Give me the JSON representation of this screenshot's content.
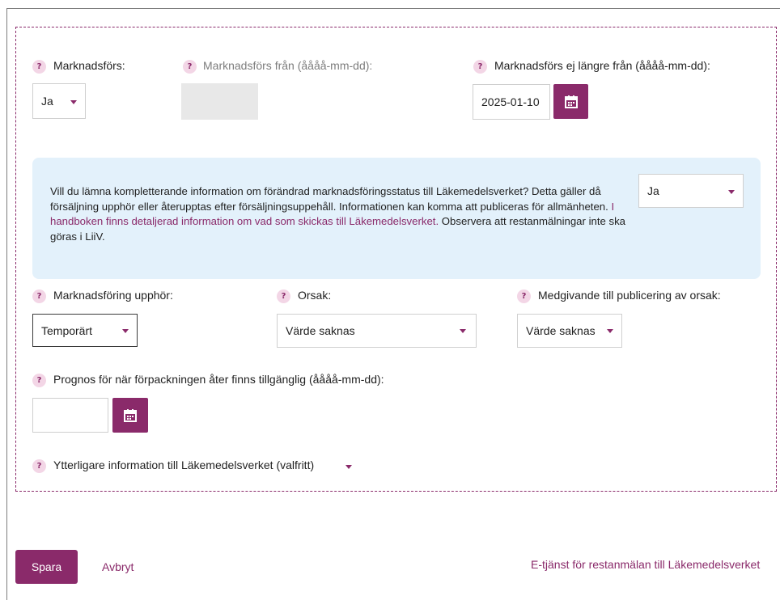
{
  "row1": {
    "marketed_label": "Marknadsförs:",
    "marketed_value": "Ja",
    "marketed_from_label": "Marknadsförs från (åååå-mm-dd):",
    "marketed_until_label": "Marknadsförs ej längre från (åååå-mm-dd):",
    "marketed_until_value": "2025-01-10"
  },
  "info": {
    "text_before": "Vill du lämna kompletterande information om förändrad marknadsföringsstatus till Läkemedelsverket? Detta gäller då försäljning upphör eller återupptas efter försäljningsuppehåll. Informationen kan komma att publiceras för allmänheten. ",
    "link_text": "I handboken finns detaljerad information om vad som skickas till Läkemedelsverket.",
    "text_after": " Observera att restanmälningar inte ska göras i LiiV.",
    "select_value": "Ja"
  },
  "row2": {
    "ceases_label": "Marknadsföring upphör:",
    "ceases_value": "Temporärt",
    "reason_label": "Orsak:",
    "reason_value": "Värde saknas",
    "consent_label": "Medgivande till publicering av orsak:",
    "consent_value": "Värde saknas"
  },
  "row3": {
    "forecast_label": "Prognos för när förpackningen åter finns tillgänglig (åååå-mm-dd):",
    "forecast_value": ""
  },
  "extra": {
    "label": "Ytterligare information till Läkemedelsverket (valfritt)"
  },
  "help_glyph": "?",
  "footer": {
    "save_label": "Spara",
    "cancel_label": "Avbryt",
    "eservice_link": "E-tjänst för restanmälan till Läkemedelsverket"
  },
  "colors": {
    "accent": "#8a2a6a",
    "info_bg": "#e3f1fb",
    "disabled_bg": "#e8e8e8"
  }
}
